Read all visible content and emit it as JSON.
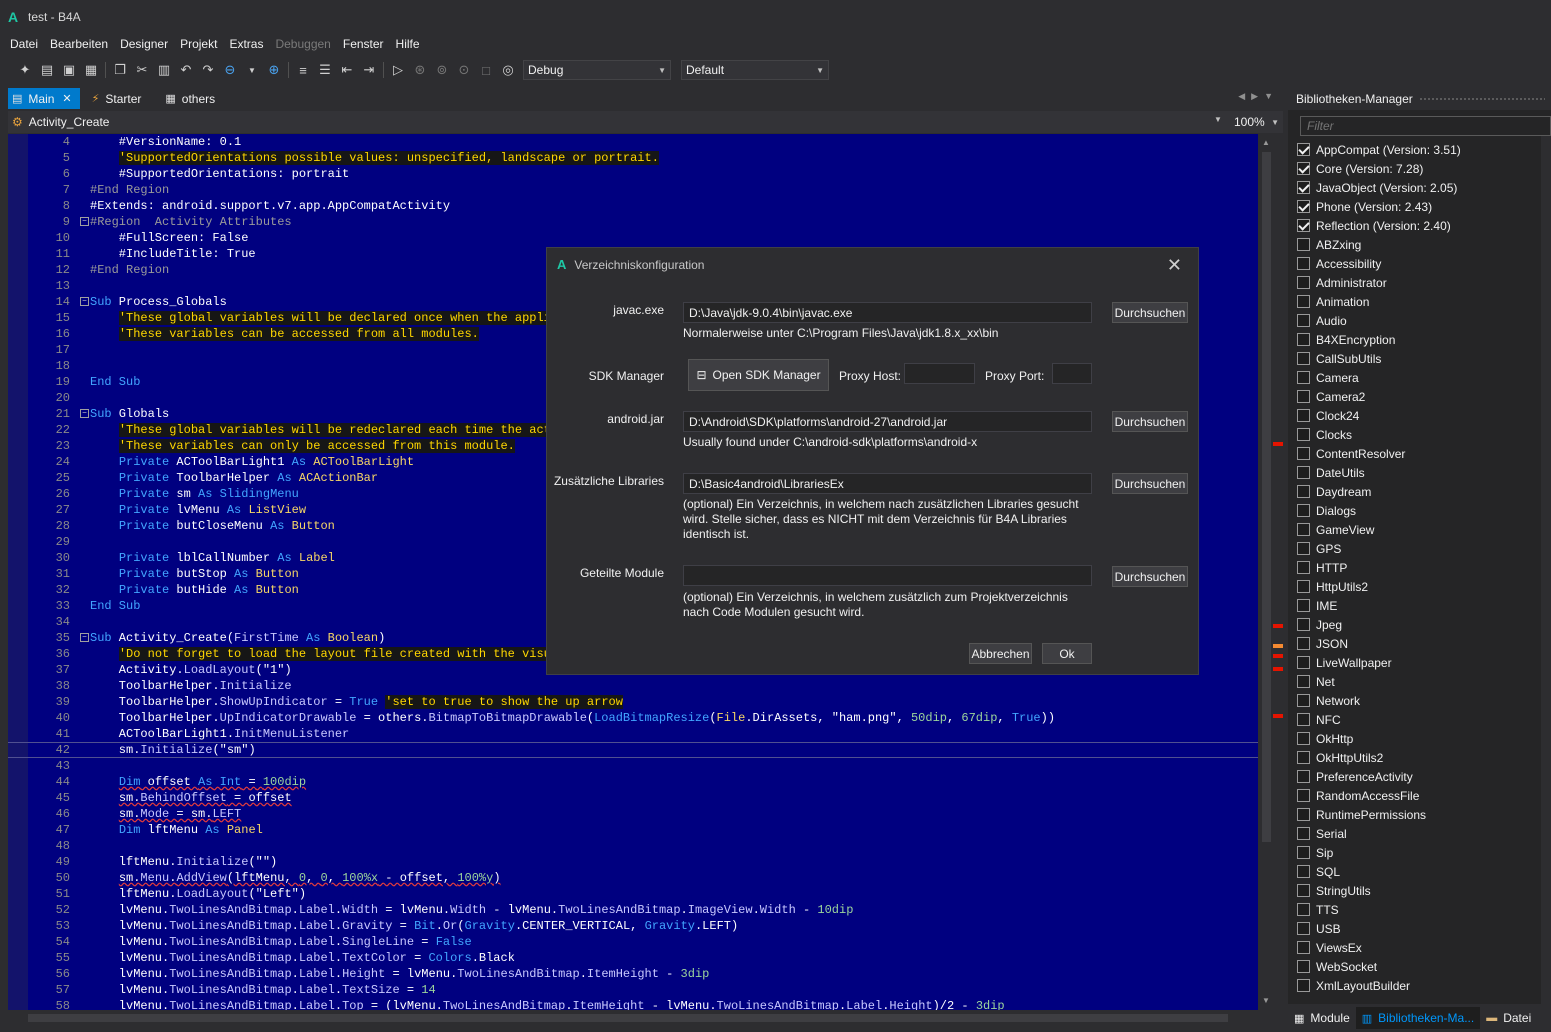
{
  "window": {
    "title": "test - B4A",
    "logo": "A"
  },
  "menu": [
    "Datei",
    "Bearbeiten",
    "Designer",
    "Projekt",
    "Extras",
    "Debuggen",
    "Fenster",
    "Hilfe"
  ],
  "toolbar": {
    "build_config": "Debug",
    "target_device": "Default"
  },
  "tabs": [
    {
      "label": "Main",
      "active": true
    },
    {
      "label": "Starter",
      "active": false
    },
    {
      "label": "others",
      "active": false
    }
  ],
  "editor": {
    "current_sub": "Activity_Create",
    "zoom": "100%",
    "lines": [
      {
        "n": "4",
        "html": "    #VersionName: 0.1"
      },
      {
        "n": "5",
        "html": "    <span class='cm'>'SupportedOrientations possible values: unspecified, landscape or portrait.</span>"
      },
      {
        "n": "6",
        "html": "    #SupportedOrientations: portrait"
      },
      {
        "n": "7",
        "html": "<span class='rg'>#End Region</span>"
      },
      {
        "n": "8",
        "html": "#Extends: android.support.v7.app.AppCompatActivity"
      },
      {
        "n": "9",
        "html": "<span class='rg'>#Region  Activity Attributes</span>",
        "fold": true
      },
      {
        "n": "10",
        "html": "    #FullScreen: False"
      },
      {
        "n": "11",
        "html": "    #IncludeTitle: True"
      },
      {
        "n": "12",
        "html": "<span class='rg'>#End Region</span>"
      },
      {
        "n": "13",
        "html": ""
      },
      {
        "n": "14",
        "html": "<span class='kw'>Sub</span> Process_Globals",
        "fold": true
      },
      {
        "n": "15",
        "html": "    <span class='cm'>'These global variables will be declared once when the applic</span>"
      },
      {
        "n": "16",
        "html": "    <span class='cm'>'These variables can be accessed from all modules.</span>"
      },
      {
        "n": "17",
        "html": ""
      },
      {
        "n": "18",
        "html": ""
      },
      {
        "n": "19",
        "html": "<span class='kw'>End Sub</span>"
      },
      {
        "n": "20",
        "html": ""
      },
      {
        "n": "21",
        "html": "<span class='kw'>Sub</span> Globals",
        "fold": true
      },
      {
        "n": "22",
        "html": "    <span class='cm'>'These global variables will be redeclared each time the acti</span>"
      },
      {
        "n": "23",
        "html": "    <span class='cm'>'These variables can only be accessed from this module.</span>"
      },
      {
        "n": "24",
        "html": "    <span class='kw'>Private</span> ACToolBarLight1 <span class='kw'>As</span> <span class='tp'>ACToolBarLight</span>"
      },
      {
        "n": "25",
        "html": "    <span class='kw'>Private</span> ToolbarHelper <span class='kw'>As</span> <span class='tp'>ACActionBar</span>"
      },
      {
        "n": "26",
        "html": "    <span class='kw'>Private</span> sm <span class='kw'>As</span> <span class='kw'>SlidingMenu</span>"
      },
      {
        "n": "27",
        "html": "    <span class='kw'>Private</span> lvMenu <span class='kw'>As</span> <span class='tp'>ListView</span>"
      },
      {
        "n": "28",
        "html": "    <span class='kw'>Private</span> butCloseMenu <span class='kw'>As</span> <span class='tp'>Button</span>"
      },
      {
        "n": "29",
        "html": ""
      },
      {
        "n": "30",
        "html": "    <span class='kw'>Private</span> lblCallNumber <span class='kw'>As</span> <span class='tp'>Label</span>"
      },
      {
        "n": "31",
        "html": "    <span class='kw'>Private</span> butStop <span class='kw'>As</span> <span class='tp'>Button</span>"
      },
      {
        "n": "32",
        "html": "    <span class='kw'>Private</span> butHide <span class='kw'>As</span> <span class='tp'>Button</span>"
      },
      {
        "n": "33",
        "html": "<span class='kw'>End Sub</span>"
      },
      {
        "n": "34",
        "html": ""
      },
      {
        "n": "35",
        "html": "<span class='kw'>Sub</span> Activity_Create(<span class='fn'>FirstTime</span> <span class='kw'>As</span> <span class='tp'>Boolean</span>)",
        "fold": true
      },
      {
        "n": "36",
        "html": "    <span class='cm'>'Do not forget to load the layout file created with the visua</span>"
      },
      {
        "n": "37",
        "html": "    Activity.<span class='fn'>LoadLayout</span>(\"1\")"
      },
      {
        "n": "38",
        "html": "    ToolbarHelper.<span class='fn'>Initialize</span>"
      },
      {
        "n": "39",
        "html": "    ToolbarHelper.<span class='fn'>ShowUpIndicator</span> = <span class='kw'>True</span> <span class='cm'>'set to true to show the up arrow</span>"
      },
      {
        "n": "40",
        "html": "    ToolbarHelper.<span class='fn'>UpIndicatorDrawable</span> = others.<span class='fn'>BitmapToBitmapDrawable</span>(<span class='kw'>LoadBitmapResize</span>(<span class='tp'>File</span>.DirAssets, \"ham.png\", <span class='num'>50dip</span>, <span class='num'>67dip</span>, <span class='kw'>True</span>))"
      },
      {
        "n": "41",
        "html": "    ACToolBarLight1.<span class='fn'>InitMenuListener</span>"
      },
      {
        "n": "42",
        "html": "    sm.<span class='fn'>Initialize</span>(\"sm\")",
        "current": true
      },
      {
        "n": "43",
        "html": ""
      },
      {
        "n": "44",
        "html": "    <span class='kw err'>Dim</span><span class='err'> offset </span><span class='kw err'>As</span><span class='err'> </span><span class='kw err'>Int</span><span class='err'> = </span><span class='num err'>100dip</span>"
      },
      {
        "n": "45",
        "html": "    <span class='err'>sm.</span><span class='fn err'>BehindOffset</span><span class='err'> = offset</span>"
      },
      {
        "n": "46",
        "html": "    <span class='err'>sm.</span><span class='fn err'>Mode</span><span class='err'> = sm.</span><span class='fn err'>LEFT</span>"
      },
      {
        "n": "47",
        "html": "    <span class='kw'>Dim</span> lftMenu <span class='kw'>As</span> <span class='tp'>Panel</span>"
      },
      {
        "n": "48",
        "html": ""
      },
      {
        "n": "49",
        "html": "    lftMenu.<span class='fn'>Initialize</span>(\"\")"
      },
      {
        "n": "50",
        "html": "    <span class='err'>sm.</span><span class='fn err'>Menu</span><span class='err'>.</span><span class='fn err'>AddView</span><span class='err'>(lftMenu, </span><span class='num err'>0</span><span class='err'>, </span><span class='num err'>0</span><span class='err'>, </span><span class='num err'>100%x</span><span class='err'> - offset, </span><span class='num err'>100%y</span><span class='err'>)</span>"
      },
      {
        "n": "51",
        "html": "    lftMenu.<span class='fn'>LoadLayout</span>(\"Left\")"
      },
      {
        "n": "52",
        "html": "    lvMenu.<span class='fn'>TwoLinesAndBitmap</span>.<span class='fn'>Label</span>.<span class='fn'>Width</span> = lvMenu.<span class='fn'>Width</span> - lvMenu.<span class='fn'>TwoLinesAndBitmap</span>.<span class='fn'>ImageView</span>.<span class='fn'>Width</span> - <span class='num'>10dip</span>"
      },
      {
        "n": "53",
        "html": "    lvMenu.<span class='fn'>TwoLinesAndBitmap</span>.<span class='fn'>Label</span>.<span class='fn'>Gravity</span> = <span class='kw'>Bit</span>.<span class='fn'>Or</span>(<span class='kw'>Gravity</span>.CENTER_VERTICAL, <span class='kw'>Gravity</span>.LEFT)"
      },
      {
        "n": "54",
        "html": "    lvMenu.<span class='fn'>TwoLinesAndBitmap</span>.<span class='fn'>Label</span>.<span class='fn'>SingleLine</span> = <span class='kw'>False</span>"
      },
      {
        "n": "55",
        "html": "    lvMenu.<span class='fn'>TwoLinesAndBitmap</span>.<span class='fn'>Label</span>.<span class='fn'>TextColor</span> = <span class='kw'>Colors</span>.Black"
      },
      {
        "n": "56",
        "html": "    lvMenu.<span class='fn'>TwoLinesAndBitmap</span>.<span class='fn'>Label</span>.<span class='fn'>Height</span> = lvMenu.<span class='fn'>TwoLinesAndBitmap</span>.<span class='fn'>ItemHeight</span> - <span class='num'>3dip</span>"
      },
      {
        "n": "57",
        "html": "    lvMenu.<span class='fn'>TwoLinesAndBitmap</span>.<span class='fn'>Label</span>.<span class='fn'>TextSize</span> = <span class='num'>14</span>"
      },
      {
        "n": "58",
        "html": "    lvMenu.<span class='fn'>TwoLinesAndBitmap</span>.<span class='fn'>Label</span>.<span class='fn'>Top</span> = (lvMenu.<span class='fn'>TwoLinesAndBitmap</span>.<span class='fn'>ItemHeight</span> - lvMenu.<span class='fn'>TwoLinesAndBitmap</span>.<span class='fn'>Label</span>.<span class='fn'>Height</span>)/2 - <span class='num'>3dip</span>"
      }
    ]
  },
  "libraries": {
    "title": "Bibliotheken-Manager",
    "filter_placeholder": "Filter",
    "items": [
      {
        "label": "AppCompat (Version: 3.51)",
        "checked": true
      },
      {
        "label": "Core (Version: 7.28)",
        "checked": true
      },
      {
        "label": "JavaObject (Version: 2.05)",
        "checked": true
      },
      {
        "label": "Phone (Version: 2.43)",
        "checked": true
      },
      {
        "label": "Reflection (Version: 2.40)",
        "checked": true
      },
      {
        "label": "ABZxing",
        "checked": false
      },
      {
        "label": "Accessibility",
        "checked": false
      },
      {
        "label": "Administrator",
        "checked": false
      },
      {
        "label": "Animation",
        "checked": false
      },
      {
        "label": "Audio",
        "checked": false
      },
      {
        "label": "B4XEncryption",
        "checked": false
      },
      {
        "label": "CallSubUtils",
        "checked": false
      },
      {
        "label": "Camera",
        "checked": false
      },
      {
        "label": "Camera2",
        "checked": false
      },
      {
        "label": "Clock24",
        "checked": false
      },
      {
        "label": "Clocks",
        "checked": false
      },
      {
        "label": "ContentResolver",
        "checked": false
      },
      {
        "label": "DateUtils",
        "checked": false
      },
      {
        "label": "Daydream",
        "checked": false
      },
      {
        "label": "Dialogs",
        "checked": false
      },
      {
        "label": "GameView",
        "checked": false
      },
      {
        "label": "GPS",
        "checked": false
      },
      {
        "label": "HTTP",
        "checked": false
      },
      {
        "label": "HttpUtils2",
        "checked": false
      },
      {
        "label": "IME",
        "checked": false
      },
      {
        "label": "Jpeg",
        "checked": false
      },
      {
        "label": "JSON",
        "checked": false
      },
      {
        "label": "LiveWallpaper",
        "checked": false
      },
      {
        "label": "Net",
        "checked": false
      },
      {
        "label": "Network",
        "checked": false
      },
      {
        "label": "NFC",
        "checked": false
      },
      {
        "label": "OkHttp",
        "checked": false
      },
      {
        "label": "OkHttpUtils2",
        "checked": false
      },
      {
        "label": "PreferenceActivity",
        "checked": false
      },
      {
        "label": "RandomAccessFile",
        "checked": false
      },
      {
        "label": "RuntimePermissions",
        "checked": false
      },
      {
        "label": "Serial",
        "checked": false
      },
      {
        "label": "Sip",
        "checked": false
      },
      {
        "label": "SQL",
        "checked": false
      },
      {
        "label": "StringUtils",
        "checked": false
      },
      {
        "label": "TTS",
        "checked": false
      },
      {
        "label": "USB",
        "checked": false
      },
      {
        "label": "ViewsEx",
        "checked": false
      },
      {
        "label": "WebSocket",
        "checked": false
      },
      {
        "label": "XmlLayoutBuilder",
        "checked": false
      }
    ]
  },
  "bottom_tabs": [
    {
      "label": "Module",
      "active": false
    },
    {
      "label": "Bibliotheken-Ma...",
      "active": true
    },
    {
      "label": "Datei",
      "active": false
    }
  ],
  "dialog": {
    "title": "Verzeichniskonfiguration",
    "javac_label": "javac.exe",
    "javac_value": "D:\\Java\\jdk-9.0.4\\bin\\javac.exe",
    "javac_hint": "Normalerweise unter C:\\Program Files\\Java\\jdk1.8.x_xx\\bin",
    "sdk_label": "SDK Manager",
    "sdk_button": "Open SDK Manager",
    "proxy_host_label": "Proxy Host:",
    "proxy_host_value": "",
    "proxy_port_label": "Proxy Port:",
    "proxy_port_value": "",
    "android_jar_label": "android.jar",
    "android_jar_value": "D:\\Android\\SDK\\platforms\\android-27\\android.jar",
    "android_jar_hint": "Usually found under C:\\android-sdk\\platforms\\android-x",
    "libs_label": "Zusätzliche Libraries",
    "libs_value": "D:\\Basic4android\\LibrariesEx",
    "libs_hint": "(optional) Ein Verzeichnis, in welchem nach zusätzlichen Libraries gesucht wird. Stelle sicher, dass es NICHT mit dem Verzeichnis für B4A Libraries identisch ist.",
    "shared_label": "Geteilte Module",
    "shared_value": "",
    "shared_hint": "(optional) Ein Verzeichnis, in welchem zusätzlich zum Projektverzeichnis nach Code Modulen gesucht wird.",
    "browse_label": "Durchsuchen",
    "cancel_label": "Abbrechen",
    "ok_label": "Ok"
  }
}
